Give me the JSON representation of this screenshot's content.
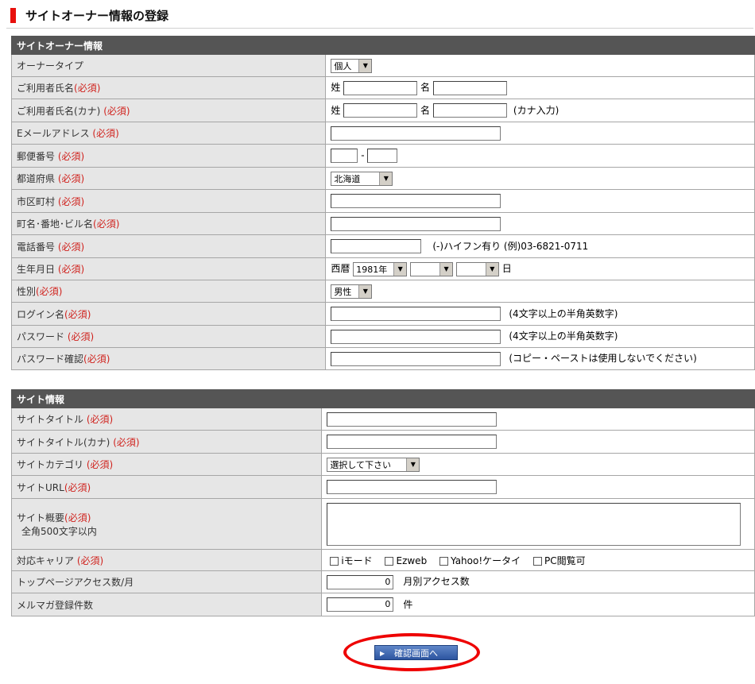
{
  "page_title": "サイトオーナー情報の登録",
  "required_label": "(必須)",
  "owner_section": {
    "heading": "サイトオーナー情報",
    "rows": {
      "owner_type": {
        "label": "オーナータイプ",
        "value": "個人"
      },
      "name": {
        "label": "ご利用者氏名",
        "sei": "姓",
        "mei": "名"
      },
      "name_kana": {
        "label": "ご利用者氏名(カナ)",
        "sei": "姓",
        "mei": "名",
        "note": "(カナ入力)"
      },
      "email": {
        "label": "Eメールアドレス"
      },
      "postal": {
        "label": "郵便番号",
        "sep": "-"
      },
      "prefecture": {
        "label": "都道府県",
        "value": "北海道"
      },
      "city": {
        "label": "市区町村"
      },
      "address": {
        "label": "町名･番地･ビル名"
      },
      "phone": {
        "label": "電話番号",
        "note": "(-)ハイフン有り (例)03-6821-0711"
      },
      "birthday": {
        "label": "生年月日",
        "era": "西暦",
        "year": "1981年",
        "day_suffix": "日"
      },
      "gender": {
        "label": "性別",
        "value": "男性"
      },
      "login": {
        "label": "ログイン名",
        "note": "(4文字以上の半角英数字)"
      },
      "password": {
        "label": "パスワード",
        "note": "(4文字以上の半角英数字)"
      },
      "password_confirm": {
        "label": "パスワード確認",
        "note": "(コピー・ペーストは使用しないでください)"
      }
    }
  },
  "site_section": {
    "heading": "サイト情報",
    "rows": {
      "title": {
        "label": "サイトタイトル"
      },
      "title_kana": {
        "label": "サイトタイトル(カナ)"
      },
      "category": {
        "label": "サイトカテゴリ",
        "value": "選択して下さい"
      },
      "url": {
        "label": "サイトURL"
      },
      "summary": {
        "label": "サイト概要",
        "sub": "全角500文字以内"
      },
      "carrier": {
        "label": "対応キャリア",
        "options": [
          "iモード",
          "Ezweb",
          "Yahoo!ケータイ",
          "PC閲覧可"
        ]
      },
      "access": {
        "label": "トップページアクセス数/月",
        "value": "0",
        "note": "月別アクセス数"
      },
      "mailmag": {
        "label": "メルマガ登録件数",
        "value": "0",
        "note": "件"
      }
    }
  },
  "submit_label": "確認画面へ",
  "colors": {
    "header_bg": "#555555",
    "label_bg": "#e6e6e6",
    "required": "#d0221d",
    "highlight": "#ee0000"
  }
}
